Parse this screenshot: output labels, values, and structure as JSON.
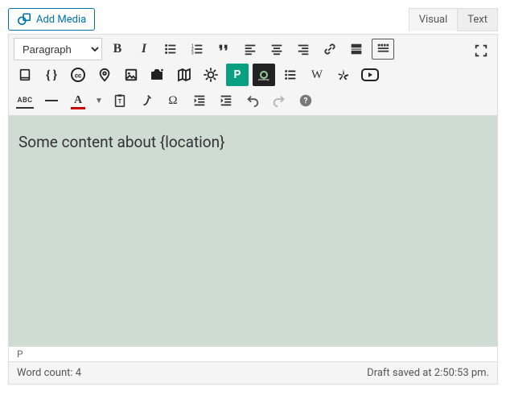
{
  "header": {
    "add_media_label": "Add Media",
    "tab_visual": "Visual",
    "tab_text": "Text"
  },
  "toolbar": {
    "format_select": "Paragraph"
  },
  "content": {
    "body": "Some content about {location}"
  },
  "footer": {
    "path": "P",
    "word_count_label": "Word count: 4",
    "draft_saved": "Draft saved at 2:50:53 pm."
  }
}
